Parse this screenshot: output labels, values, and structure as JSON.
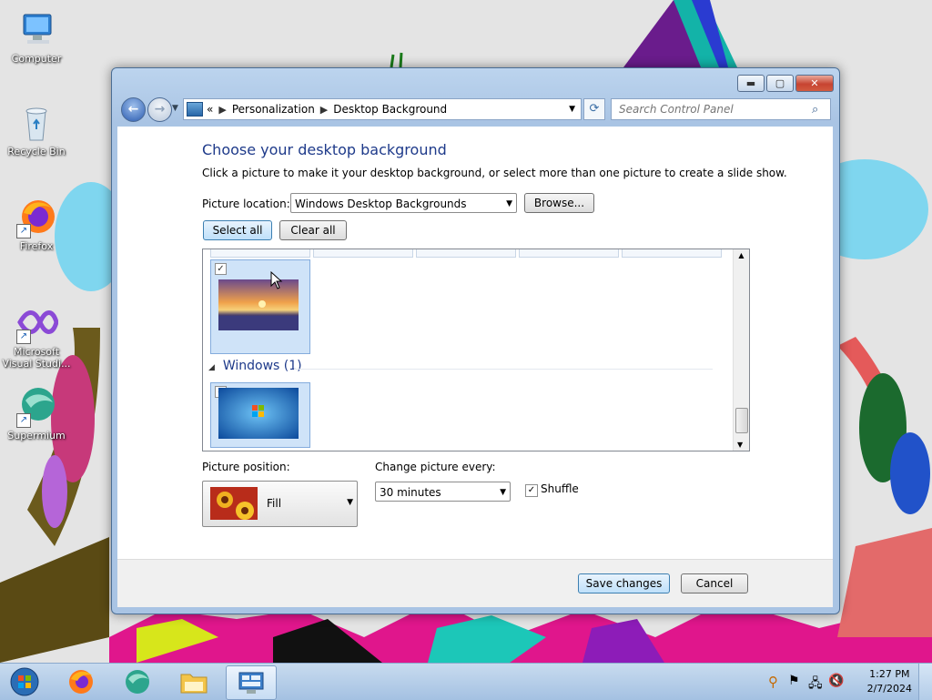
{
  "desktop": {
    "icons": [
      {
        "label": "Computer",
        "icon": "computer-icon"
      },
      {
        "label": "Recycle Bin",
        "icon": "recycle-bin-icon"
      },
      {
        "label": "Firefox",
        "icon": "firefox-icon"
      },
      {
        "label": "Microsoft Visual Studi...",
        "icon": "visual-studio-icon"
      },
      {
        "label": "Supermium",
        "icon": "supermium-icon"
      }
    ]
  },
  "window": {
    "breadcrumb": {
      "overflow": "«",
      "items": [
        "Personalization",
        "Desktop Background"
      ]
    },
    "search_placeholder": "Search Control Panel",
    "heading": "Choose your desktop background",
    "description": "Click a picture to make it your desktop background, or select more than one picture to create a slide show.",
    "picture_location_label": "Picture location:",
    "picture_location_value": "Windows Desktop Backgrounds",
    "browse_label": "Browse...",
    "select_all_label": "Select all",
    "clear_all_label": "Clear all",
    "gallery": {
      "groups": [
        {
          "name": "",
          "items": [
            {
              "thumbnail": "sunset-lake-thumbnail",
              "checked": true
            }
          ]
        },
        {
          "name": "Windows (1)",
          "items": [
            {
              "thumbnail": "windows-7-thumbnail",
              "checked": true
            }
          ]
        }
      ]
    },
    "picture_position_label": "Picture position:",
    "picture_position_value": "Fill",
    "change_picture_label": "Change picture every:",
    "change_picture_value": "30 minutes",
    "shuffle_label": "Shuffle",
    "shuffle_checked": true,
    "save_label": "Save changes",
    "cancel_label": "Cancel"
  },
  "taskbar": {
    "apps": [
      "start-orb",
      "firefox",
      "supermium",
      "file-explorer",
      "control-panel"
    ],
    "time": "1:27 PM",
    "date": "2/7/2024"
  }
}
